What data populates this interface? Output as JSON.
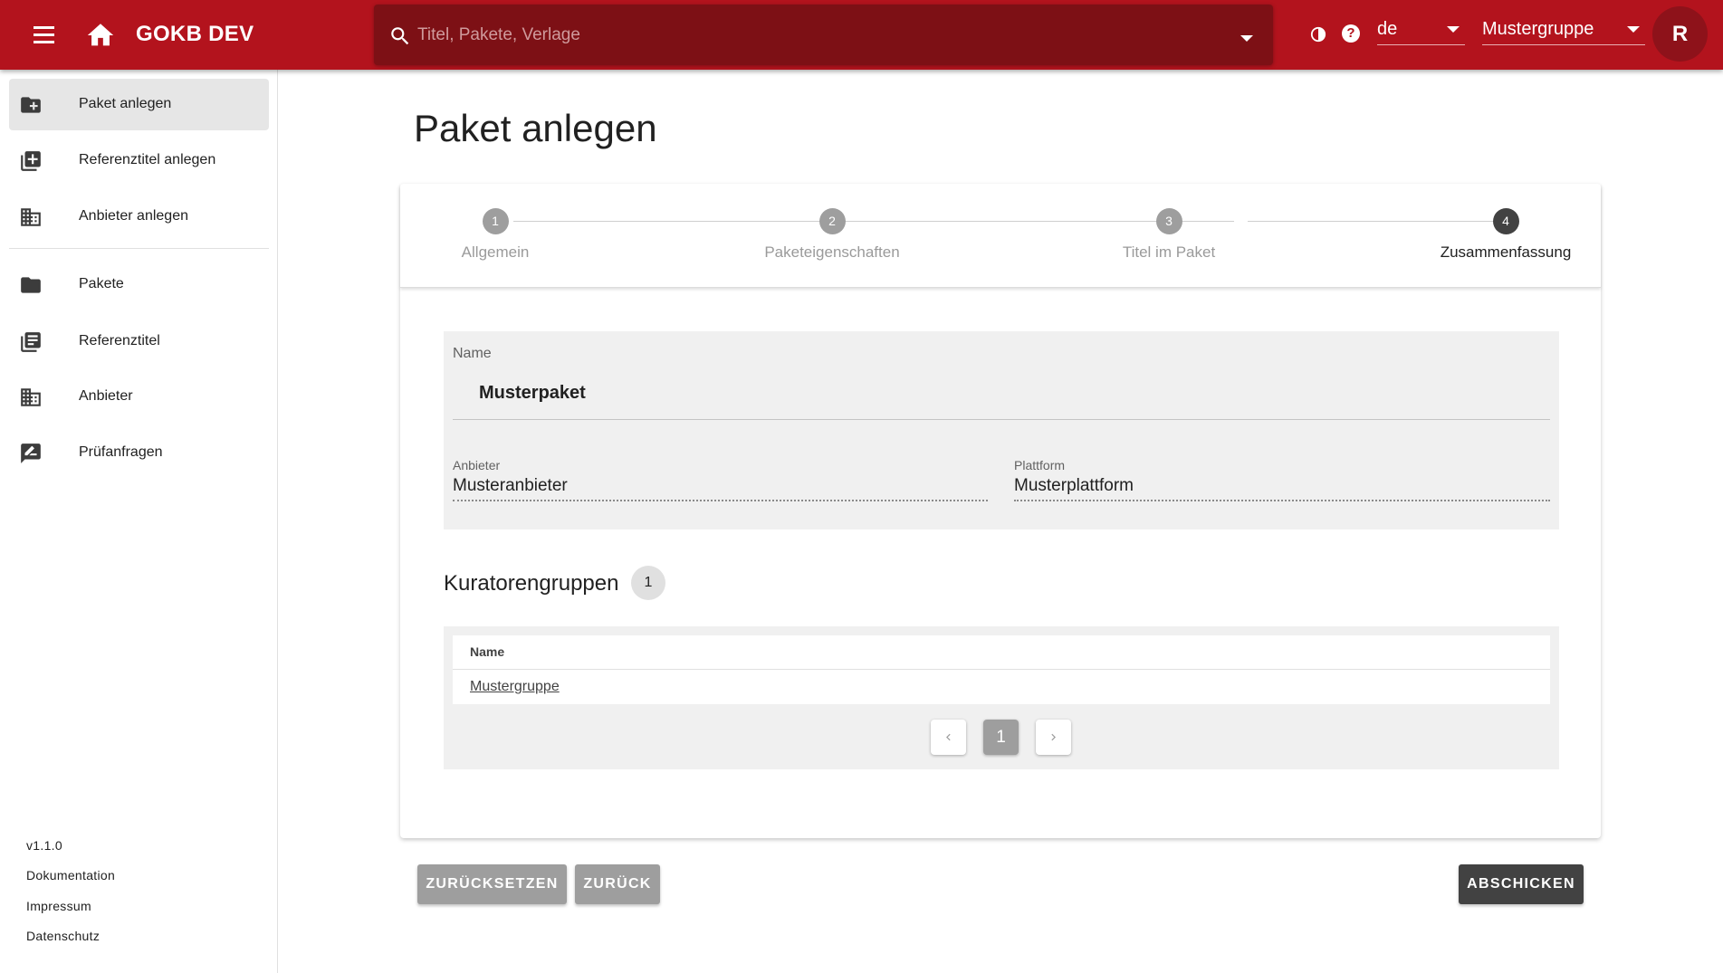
{
  "header": {
    "app_title": "GOKB DEV",
    "search_placeholder": "Titel, Pakete, Verlage",
    "language": "de",
    "group": "Mustergruppe",
    "avatar_initial": "R",
    "brand_color": "#b3131d"
  },
  "sidebar": {
    "items": [
      {
        "label": "Paket anlegen",
        "icon": "create-package-icon",
        "active": true
      },
      {
        "label": "Referenztitel anlegen",
        "icon": "add-title-icon"
      },
      {
        "label": "Anbieter anlegen",
        "icon": "building-icon"
      },
      {
        "label": "Pakete",
        "icon": "folder-icon"
      },
      {
        "label": "Referenztitel",
        "icon": "title-list-icon"
      },
      {
        "label": "Anbieter",
        "icon": "building-icon"
      },
      {
        "label": "Prüfanfragen",
        "icon": "review-icon"
      }
    ],
    "footer": {
      "version": "v1.1.0",
      "docs": "Dokumentation",
      "imprint": "Impressum",
      "privacy": "Datenschutz"
    }
  },
  "main": {
    "title": "Paket anlegen",
    "steps": [
      {
        "num": "1",
        "label": "Allgemein"
      },
      {
        "num": "2",
        "label": "Paketeigenschaften"
      },
      {
        "num": "3",
        "label": "Titel im Paket"
      },
      {
        "num": "4",
        "label": "Zusammenfassung",
        "active": true
      }
    ],
    "summary": {
      "name_label": "Name",
      "name_value": "Musterpaket",
      "provider_label": "Anbieter",
      "provider_value": "Musteranbieter",
      "platform_label": "Plattform",
      "platform_value": "Musterplattform"
    },
    "curators": {
      "title": "Kuratorengruppen",
      "count": "1",
      "column": "Name",
      "rows": [
        "Mustergruppe"
      ],
      "page": "1"
    },
    "buttons": {
      "reset": "ZURÜCKSETZEN",
      "back": "ZURÜCK",
      "submit": "ABSCHICKEN"
    }
  }
}
